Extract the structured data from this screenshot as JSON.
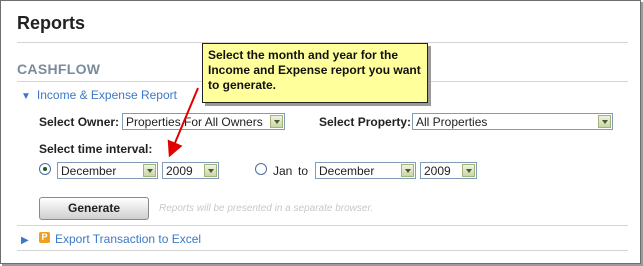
{
  "page": {
    "title": "Reports"
  },
  "section": {
    "title": "CASHFLOW"
  },
  "income_report": {
    "label": "Income & Expense Report",
    "owner_label": "Select Owner:",
    "owner_value": "Properties For All Owners",
    "property_label": "Select Property:",
    "property_value": "All Properties",
    "interval_label": "Select time interval:",
    "single_month": "December",
    "single_year": "2009",
    "range_from_label": "Jan",
    "range_to_label": "to",
    "range_month": "December",
    "range_year": "2009",
    "generate_label": "Generate",
    "note": "Reports will be presented in a separate browser."
  },
  "export": {
    "icon_letter": "P",
    "label": "Export Transaction to Excel"
  },
  "callout": {
    "text": "Select the month and year for the Income and Expense report you want to generate."
  },
  "colors": {
    "callout_bg": "#ffff9c",
    "link": "#3c78c8",
    "section": "#7a8b9a"
  }
}
